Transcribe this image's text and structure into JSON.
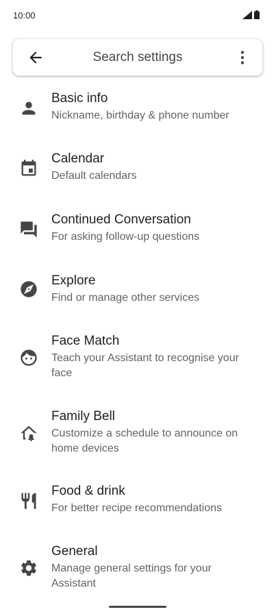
{
  "status_bar": {
    "time": "10:00",
    "icons": [
      "signal-icon",
      "battery-icon"
    ]
  },
  "search": {
    "placeholder": "Search settings",
    "back_icon": "arrow-back-icon",
    "more_icon": "more-vert-icon"
  },
  "items": [
    {
      "title": "Basic info",
      "subtitle": "Nickname, birthday & phone number",
      "icon": "person-icon"
    },
    {
      "title": "Calendar",
      "subtitle": "Default calendars",
      "icon": "calendar-icon"
    },
    {
      "title": "Continued Conversation",
      "subtitle": "For asking follow-up questions",
      "icon": "chat-icon"
    },
    {
      "title": "Explore",
      "subtitle": "Find or manage other services",
      "icon": "compass-icon"
    },
    {
      "title": "Face Match",
      "subtitle": "Teach your Assistant to recognise your face",
      "icon": "face-icon"
    },
    {
      "title": "Family Bell",
      "subtitle": "Customize a schedule to announce on home devices",
      "icon": "home-bell-icon"
    },
    {
      "title": "Food & drink",
      "subtitle": "For better recipe recommendations",
      "icon": "restaurant-icon"
    },
    {
      "title": "General",
      "subtitle": "Manage general settings for your Assistant",
      "icon": "gear-icon"
    }
  ],
  "colors": {
    "text_primary": "#1f1f1f",
    "text_secondary": "#5f6368",
    "icon": "#444746",
    "background": "#ffffff"
  }
}
